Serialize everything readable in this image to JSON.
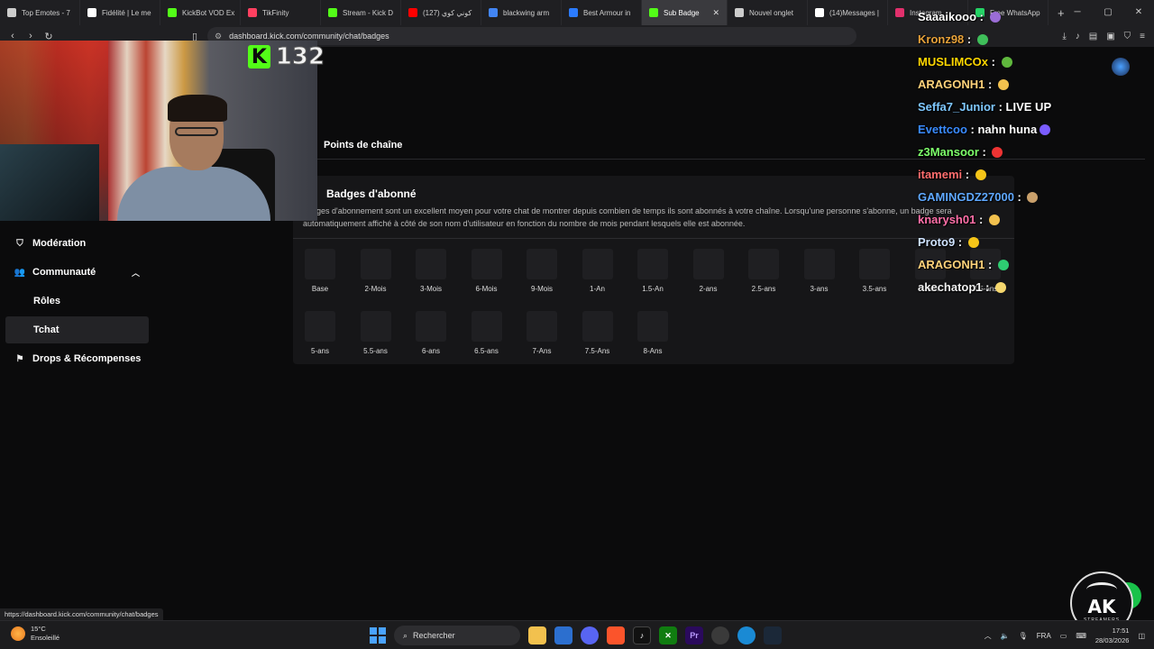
{
  "browser": {
    "tabs": [
      {
        "label": "Top Emotes - 7",
        "color": "#cccccc"
      },
      {
        "label": "Fidélité | Le me",
        "color": "#ffffff"
      },
      {
        "label": "KickBot VOD Ex",
        "color": "#53fc18"
      },
      {
        "label": "TikFinity",
        "color": "#ff4060"
      },
      {
        "label": "Stream - Kick D",
        "color": "#53fc18"
      },
      {
        "label": "(127) كوني كوي",
        "color": "#ff0000"
      },
      {
        "label": "blackwing arm",
        "color": "#4285f4"
      },
      {
        "label": "Best Armour in",
        "color": "#2b7bff"
      },
      {
        "label": "Sub Badge",
        "color": "#53fc18"
      },
      {
        "label": "Nouvel onglet",
        "color": "#cccccc"
      },
      {
        "label": "(14)Messages |",
        "color": "#ffffff"
      },
      {
        "label": "Instagram",
        "color": "#e1306c"
      },
      {
        "label": "Free WhatsApp",
        "color": "#25d366"
      }
    ],
    "active_tab_index": 8,
    "url": "dashboard.kick.com/community/chat/badges",
    "status_url": "https://dashboard.kick.com/community/chat/badges"
  },
  "stream": {
    "viewer_count": "132"
  },
  "sidebar": {
    "items": [
      {
        "label": "Modération",
        "icon": "shield-icon"
      },
      {
        "label": "Communauté",
        "icon": "people-icon"
      },
      {
        "label": "Rôles",
        "icon": ""
      },
      {
        "label": "Tchat",
        "icon": ""
      },
      {
        "label": "Drops & Récompenses",
        "icon": "gift-icon"
      }
    ]
  },
  "main": {
    "points_title": "Points de chaîne",
    "badges_title": "Badges d'abonné",
    "badges_desc": "badges d'abonnement sont un excellent moyen pour votre chat de montrer depuis combien de temps ils sont abonnés à votre chaîne. Lorsqu'une personne s'abonne, un badge sera automatiquement affiché à côté de son nom d'utilisateur en fonction du nombre de mois pendant lesquels elle est abonnée.",
    "badges": [
      "Base",
      "2-Mois",
      "3-Mois",
      "6-Mois",
      "9-Mois",
      "1-An",
      "1.5-An",
      "2-ans",
      "2.5-ans",
      "3-ans",
      "3.5-ans",
      "4-ans",
      "4.5-ans",
      "5-ans",
      "5.5-ans",
      "6-ans",
      "6.5-ans",
      "7-Ans",
      "7.5-Ans",
      "8-Ans"
    ]
  },
  "chat": [
    {
      "user": "Saaaikooo",
      "text": "",
      "color": "#ffffff"
    },
    {
      "user": "Kronz98",
      "text": "",
      "color": "#e8a23a"
    },
    {
      "user": "MUSLIMCOx",
      "text": "",
      "color": "#ffd700"
    },
    {
      "user": "ARAGONH1",
      "text": "",
      "color": "#ffd27a"
    },
    {
      "user": "Seffa7_Junior",
      "text": "LIVE UP",
      "color": "#7fc8ff"
    },
    {
      "user": "Evettcoo",
      "text": "nahn huna",
      "color": "#3a8bff"
    },
    {
      "user": "z3Mansoor",
      "text": "",
      "color": "#7dff6a"
    },
    {
      "user": "itamemi",
      "text": "",
      "color": "#ff6d6d"
    },
    {
      "user": "GAMINGDZ27000",
      "text": "",
      "color": "#5fa8ff"
    },
    {
      "user": "knarysh01",
      "text": "",
      "color": "#ff6fa8"
    },
    {
      "user": "Proto9",
      "text": "",
      "color": "#cfe3ff"
    },
    {
      "user": "ARAGONH1",
      "text": "",
      "color": "#ffd27a"
    },
    {
      "user": "akechatop1",
      "text": "",
      "color": "#f0f0f0"
    }
  ],
  "taskbar": {
    "temperature": "15°C",
    "weather": "Ensoleillé",
    "search_placeholder": "Rechercher",
    "language": "FRA",
    "time": "17:51",
    "date": "28/03/2026"
  },
  "logo": {
    "text": "AK",
    "subtext": "STREAMERS"
  }
}
